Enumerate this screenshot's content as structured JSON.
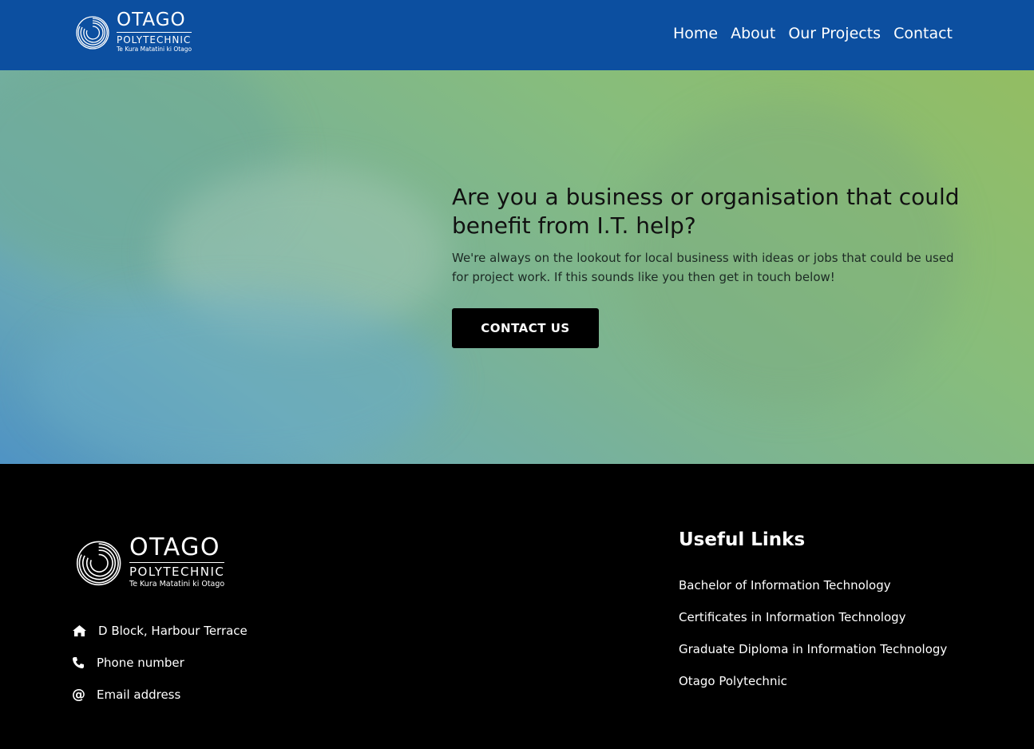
{
  "header": {
    "logo": {
      "name": "OTAGO",
      "sub": "POLYTECHNIC",
      "tagline": "Te Kura Matatini ki Otago"
    },
    "nav": [
      "Home",
      "About",
      "Our Projects",
      "Contact"
    ],
    "background_color": "#0c4fa0"
  },
  "hero": {
    "title": "Are you a business or organisation that could benefit from I.T. help?",
    "text": "We're always on the lookout for local business with ideas or jobs that could be used for project work. If this sounds like you then get in touch below!",
    "button_label": "CONTACT US"
  },
  "footer": {
    "logo": {
      "name": "OTAGO",
      "sub": "POLYTECHNIC",
      "tagline": "Te Kura Matatini ki Otago"
    },
    "contact": [
      {
        "icon": "home-icon",
        "text": "D Block, Harbour Terrace"
      },
      {
        "icon": "phone-icon",
        "text": "Phone number"
      },
      {
        "icon": "at-icon",
        "text": "Email address"
      }
    ],
    "links_title": "Useful Links",
    "links": [
      "Bachelor of Information Technology",
      "Certificates in Information Technology",
      "Graduate Diploma in Information Technology",
      "Otago Polytechnic"
    ]
  }
}
